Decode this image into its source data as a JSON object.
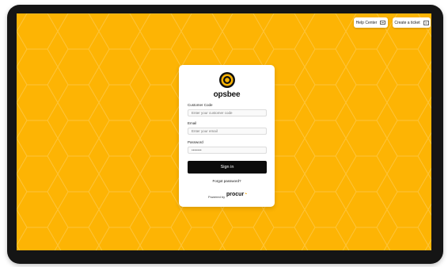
{
  "header": {
    "help_center": "Help Center",
    "create_ticket": "Create a ticket"
  },
  "brand": {
    "name": "opsbee",
    "accent": "#fdb404",
    "logo_icon": "target-icon"
  },
  "form": {
    "customer_code_label": "Customer Code",
    "customer_code_placeholder": "Enter your customer code",
    "email_label": "Email",
    "email_placeholder": "Enter your email",
    "password_label": "Password",
    "password_placeholder": "••••••••",
    "sign_in": "Sign in",
    "forgot_password": "Forgot password?"
  },
  "footer": {
    "powered_by": "Powered by",
    "partner": "procur"
  }
}
